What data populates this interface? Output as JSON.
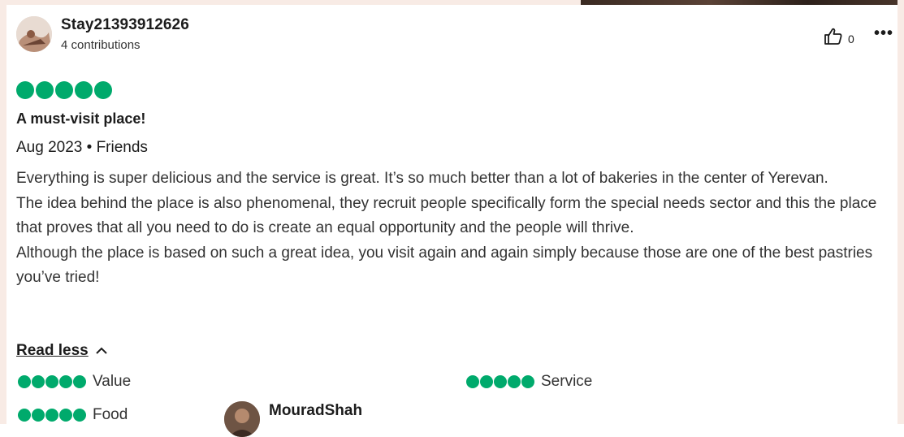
{
  "review": {
    "username": "Stay21393912626",
    "contributions": "4 contributions",
    "helpful_count": "0",
    "more_icon": "more-icon",
    "rating_value": 5,
    "rating_max": 5,
    "title": "A must-visit place!",
    "meta": "Aug 2023 • Friends",
    "paragraphs": [
      "Everything is super delicious and the service is great. It’s so much better than a lot of bakeries in the center of Yerevan.",
      "The idea behind the place is also phenomenal, they recruit people specifically form the special needs sector and this the place that proves that all you need to do is create an equal opportunity and the people will thrive.",
      "Although the place is based on such a great idea, you visit again and again simply because those are one of the best pastries you’ve tried!"
    ],
    "read_less": "Read less",
    "subratings": [
      {
        "label": "Value",
        "value": 5
      },
      {
        "label": "Service",
        "value": 5
      },
      {
        "label": "Food",
        "value": 5
      }
    ]
  },
  "next_review": {
    "username": "MouradShah"
  },
  "colors": {
    "rating_green": "#00aa6c",
    "page_accent": "#f8ebe5"
  }
}
